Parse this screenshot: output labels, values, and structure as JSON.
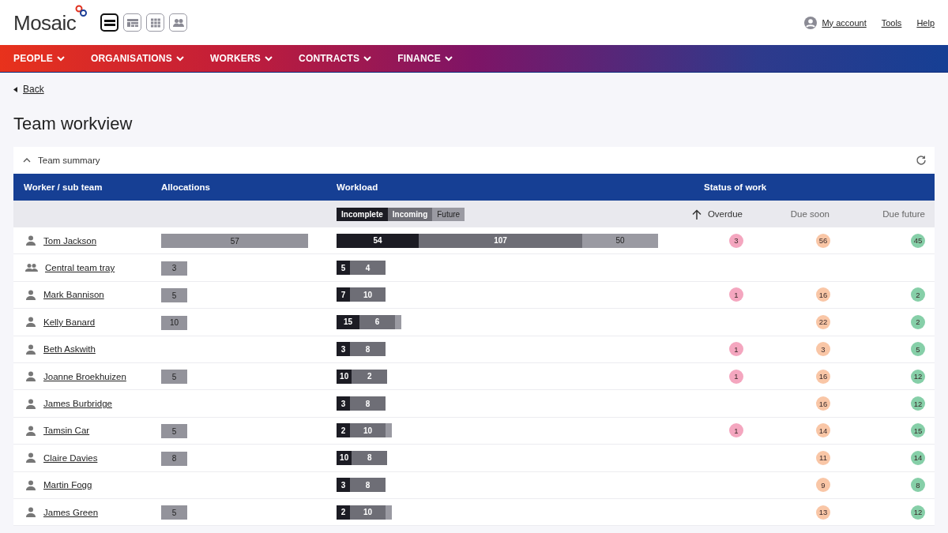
{
  "header": {
    "logo": "Mosaic",
    "views": [
      {
        "kind": "list",
        "selected": true
      },
      {
        "kind": "dashboard",
        "selected": false
      },
      {
        "kind": "grid",
        "selected": false
      },
      {
        "kind": "team",
        "selected": false
      }
    ],
    "links": [
      "My account",
      "Tools",
      "Help"
    ]
  },
  "nav": [
    "PEOPLE",
    "ORGANISATIONS",
    "WORKERS",
    "CONTRACTS",
    "FINANCE"
  ],
  "back": "Back",
  "title": "Team workview",
  "panel": {
    "title": "Team summary",
    "expanded": true
  },
  "table": {
    "columns": [
      "Worker / sub team",
      "Allocations",
      "Workload",
      "Status of work"
    ],
    "legend": [
      {
        "kind": "incomplete",
        "label": "Incomplete"
      },
      {
        "kind": "incoming",
        "label": "Incoming"
      },
      {
        "kind": "future",
        "label": "Future"
      }
    ],
    "status_columns": [
      {
        "kind": "overdue",
        "label": "Overdue",
        "sorted": true,
        "color": "#f4a6bf"
      },
      {
        "kind": "due_soon",
        "label": "Due soon",
        "sorted": false,
        "color": "#f9c6a6"
      },
      {
        "kind": "due_future",
        "label": "Due future",
        "sorted": false,
        "color": "#86cfa8"
      }
    ],
    "rows": [
      {
        "kind": "worker",
        "name": "Tom Jackson",
        "allocations": "57",
        "workload": [
          {
            "kind": "incomplete",
            "value": "54"
          },
          {
            "kind": "incoming",
            "value": "107"
          },
          {
            "kind": "future",
            "value": "50"
          }
        ],
        "status": {
          "overdue": "3",
          "due_soon": "56",
          "due_future": "45"
        }
      },
      {
        "kind": "team",
        "name": "Central team tray",
        "allocations": "3",
        "workload": [
          {
            "kind": "incomplete",
            "value": "5"
          },
          {
            "kind": "incoming",
            "value": "4"
          }
        ]
      },
      {
        "kind": "worker",
        "name": "Mark Bannison",
        "allocations": "5",
        "workload": [
          {
            "kind": "incomplete",
            "value": "7"
          },
          {
            "kind": "incoming",
            "value": "10"
          }
        ],
        "status": {
          "overdue": "1",
          "due_soon": "16",
          "due_future": "2"
        }
      },
      {
        "kind": "worker",
        "name": "Kelly Banard",
        "allocations": "10",
        "workload": [
          {
            "kind": "incomplete",
            "value": "15"
          },
          {
            "kind": "incoming",
            "value": "6"
          },
          {
            "kind": "future"
          }
        ],
        "status": {
          "due_soon": "22",
          "due_future": "2"
        }
      },
      {
        "kind": "worker",
        "name": "Beth Askwith",
        "workload": [
          {
            "kind": "incomplete",
            "value": "3"
          },
          {
            "kind": "incoming",
            "value": "8"
          }
        ],
        "status": {
          "overdue": "1",
          "due_soon": "3",
          "due_future": "5"
        }
      },
      {
        "kind": "worker",
        "name": "Joanne Broekhuizen",
        "allocations": "5",
        "workload": [
          {
            "kind": "incomplete",
            "value": "10"
          },
          {
            "kind": "incoming",
            "value": "2"
          }
        ],
        "status": {
          "overdue": "1",
          "due_soon": "16",
          "due_future": "12"
        }
      },
      {
        "kind": "worker",
        "name": "James Burbridge",
        "workload": [
          {
            "kind": "incomplete",
            "value": "3"
          },
          {
            "kind": "incoming",
            "value": "8"
          }
        ],
        "status": {
          "due_soon": "16",
          "due_future": "12"
        }
      },
      {
        "kind": "worker",
        "name": "Tamsin Car",
        "allocations": "5",
        "workload": [
          {
            "kind": "incomplete",
            "value": "2"
          },
          {
            "kind": "incoming",
            "value": "10"
          },
          {
            "kind": "future"
          }
        ],
        "status": {
          "overdue": "1",
          "due_soon": "14",
          "due_future": "15"
        }
      },
      {
        "kind": "worker",
        "name": "Claire Davies",
        "allocations": "8",
        "workload": [
          {
            "kind": "incomplete",
            "value": "10"
          },
          {
            "kind": "incoming",
            "value": "8"
          }
        ],
        "status": {
          "due_soon": "11",
          "due_future": "14"
        }
      },
      {
        "kind": "worker",
        "name": "Martin Fogg",
        "workload": [
          {
            "kind": "incomplete",
            "value": "3"
          },
          {
            "kind": "incoming",
            "value": "8"
          }
        ],
        "status": {
          "due_soon": "9",
          "due_future": "8"
        }
      },
      {
        "kind": "worker",
        "name": "James Green",
        "allocations": "5",
        "workload": [
          {
            "kind": "incomplete",
            "value": "2"
          },
          {
            "kind": "incoming",
            "value": "10"
          },
          {
            "kind": "future"
          }
        ],
        "status": {
          "due_soon": "13",
          "due_future": "12"
        }
      }
    ]
  }
}
